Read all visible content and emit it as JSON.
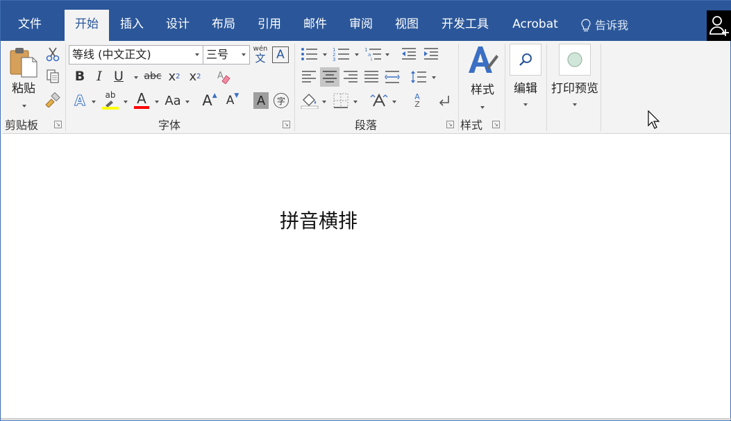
{
  "menu": {
    "tabs": [
      {
        "label": "文件",
        "active": false
      },
      {
        "label": "开始",
        "active": true
      },
      {
        "label": "插入",
        "active": false
      },
      {
        "label": "设计",
        "active": false
      },
      {
        "label": "布局",
        "active": false
      },
      {
        "label": "引用",
        "active": false
      },
      {
        "label": "邮件",
        "active": false
      },
      {
        "label": "审阅",
        "active": false
      },
      {
        "label": "视图",
        "active": false
      },
      {
        "label": "开发工具",
        "active": false
      },
      {
        "label": "Acrobat",
        "active": false
      }
    ],
    "tell_me": "告诉我"
  },
  "ribbon": {
    "clipboard": {
      "paste_label": "粘贴",
      "group_label": "剪贴板"
    },
    "font": {
      "font_name": "等线 (中文正文)",
      "font_size": "三号",
      "phonetic_top": "wén",
      "phonetic_bottom": "文",
      "border_char": "A",
      "bold": "B",
      "italic": "I",
      "underline": "U",
      "strike": "abc",
      "subscript": "x",
      "subscript_mark": "2",
      "superscript": "x",
      "superscript_mark": "2",
      "text_effect": "A",
      "highlight": "ab",
      "font_color": "A",
      "change_case": "Aa",
      "grow": "A",
      "shrink": "A",
      "shading_char": "A",
      "enclose_char": "字",
      "group_label": "字体"
    },
    "paragraph": {
      "group_label": "段落",
      "sort_a": "A",
      "sort_z": "Z"
    },
    "styles": {
      "label": "样式",
      "group_label": "样式"
    },
    "editing": {
      "label": "编辑"
    },
    "print_preview": {
      "label": "打印预览"
    }
  },
  "document": {
    "text": "拼音横排"
  },
  "colors": {
    "accent": "#2b579a",
    "highlight": "#ffff00",
    "font_color": "#ff0000"
  }
}
